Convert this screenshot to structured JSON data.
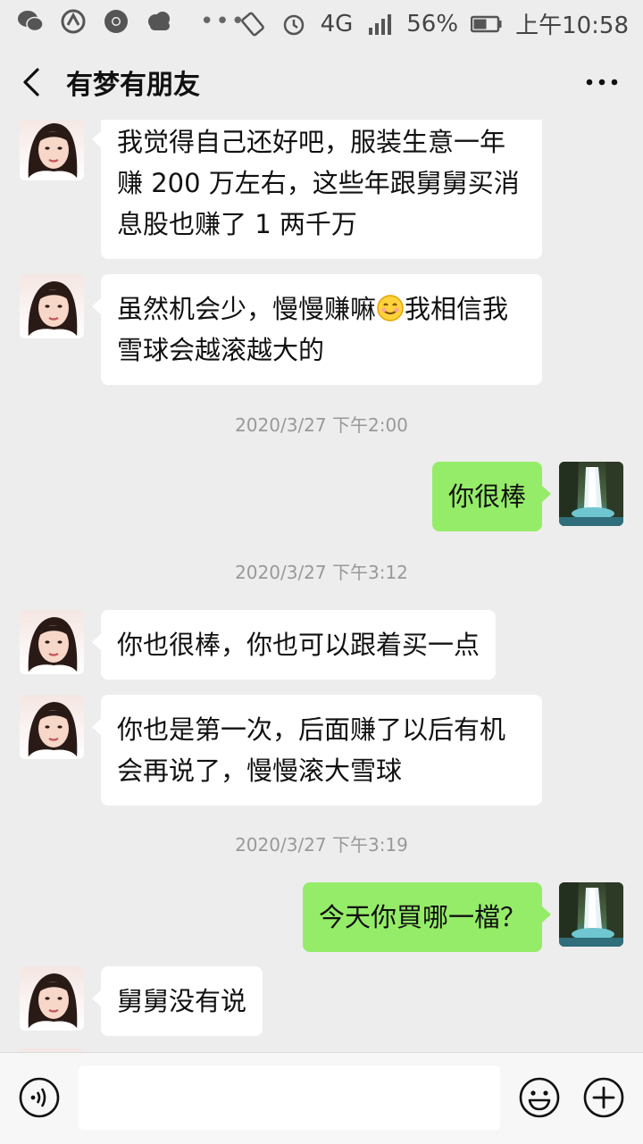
{
  "status_bar": {
    "battery_percent": "56%",
    "network": "4G",
    "time": "上午10:58",
    "icons": [
      "wechat-icon",
      "app-icon",
      "chrome-icon",
      "cloud-icon",
      "more-dots-icon",
      "vibrate-icon",
      "alarm-icon",
      "signal-icon",
      "battery-icon"
    ]
  },
  "header": {
    "title": "有梦有朋友",
    "back_icon": "chevron-left-icon",
    "more_icon": "ellipsis-icon"
  },
  "messages": [
    {
      "side": "in",
      "text": "我觉得自己还好吧，服装生意一年赚 200 万左右，这些年跟舅舅买消息股也赚了 1 两千万"
    },
    {
      "side": "in",
      "text_before": "虽然机会少，慢慢赚嘛",
      "emoji": "smile-emoji",
      "text_after": "我相信我雪球会越滚越大的"
    },
    {
      "timestamp": "2020/3/27 下午2:00"
    },
    {
      "side": "out",
      "text": "你很棒"
    },
    {
      "timestamp": "2020/3/27 下午3:12"
    },
    {
      "side": "in",
      "text": "你也很棒，你也可以跟着买一点"
    },
    {
      "side": "in",
      "text": "你也是第一次，后面赚了以后有机会再说了，慢慢滚大雪球"
    },
    {
      "timestamp": "2020/3/27 下午3:19"
    },
    {
      "side": "out",
      "text": "今天你買哪一檔？"
    },
    {
      "side": "in",
      "text": "舅舅没有说"
    }
  ],
  "input_bar": {
    "placeholder": "",
    "value": "",
    "icons": [
      "voice-icon",
      "emoji-icon",
      "plus-icon"
    ]
  },
  "colors": {
    "background": "#ededed",
    "incoming_bubble": "#ffffff",
    "outgoing_bubble": "#95ec69",
    "timestamp": "#999999"
  }
}
